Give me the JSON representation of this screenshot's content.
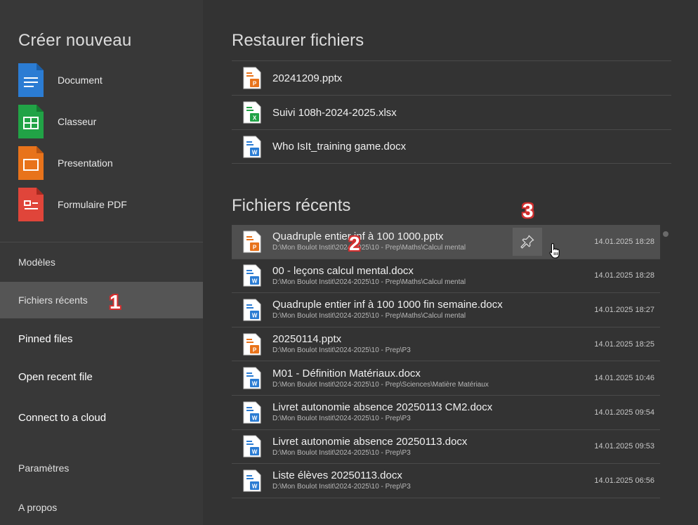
{
  "sidebar": {
    "create_title": "Créer nouveau",
    "create_items": [
      {
        "label": "Document",
        "icon": "word-doc-icon",
        "color": "#2b7cd3"
      },
      {
        "label": "Classeur",
        "icon": "spreadsheet-icon",
        "color": "#21a346"
      },
      {
        "label": "Presentation",
        "icon": "presentation-icon",
        "color": "#e8731b"
      },
      {
        "label": "Formulaire PDF",
        "icon": "pdf-form-icon",
        "color": "#e0453a"
      }
    ],
    "nav": {
      "models": "Modèles",
      "recent": "Fichiers récents",
      "pinned": "Pinned files",
      "open_recent": "Open recent file",
      "cloud": "Connect to a cloud",
      "settings": "Paramètres",
      "about": "A propos"
    }
  },
  "annotations": {
    "one": "1",
    "two": "2",
    "three": "3"
  },
  "main": {
    "restore_title": "Restaurer fichiers",
    "restore_files": [
      {
        "name": "20241209.pptx",
        "type": "pptx"
      },
      {
        "name": "Suivi 108h-2024-2025.xlsx",
        "type": "xlsx"
      },
      {
        "name": "Who IsIt_training game.docx",
        "type": "docx"
      }
    ],
    "recent_title": "Fichiers récents",
    "recent_files": [
      {
        "name": "Quadruple entier inf à 100 1000.pptx",
        "path": "D:\\Mon Boulot Instit\\2024-2025\\10 - Prep\\Maths\\Calcul mental",
        "date": "14.01.2025 18:28",
        "type": "pptx"
      },
      {
        "name": "00 - leçons calcul mental.docx",
        "path": "D:\\Mon Boulot Instit\\2024-2025\\10 - Prep\\Maths\\Calcul mental",
        "date": "14.01.2025 18:28",
        "type": "docx"
      },
      {
        "name": "Quadruple entier inf à 100 1000 fin semaine.docx",
        "path": "D:\\Mon Boulot Instit\\2024-2025\\10 - Prep\\Maths\\Calcul mental",
        "date": "14.01.2025 18:27",
        "type": "docx"
      },
      {
        "name": "20250114.pptx",
        "path": "D:\\Mon Boulot Instit\\2024-2025\\10 - Prep\\P3",
        "date": "14.01.2025 18:25",
        "type": "pptx"
      },
      {
        "name": "M01 - Définition Matériaux.docx",
        "path": "D:\\Mon Boulot Instit\\2024-2025\\10 - Prep\\Sciences\\Matière Matériaux",
        "date": "14.01.2025 10:46",
        "type": "docx"
      },
      {
        "name": "Livret autonomie absence 20250113 CM2.docx",
        "path": "D:\\Mon Boulot Instit\\2024-2025\\10 - Prep\\P3",
        "date": "14.01.2025 09:54",
        "type": "docx"
      },
      {
        "name": "Livret autonomie absence 20250113.docx",
        "path": "D:\\Mon Boulot Instit\\2024-2025\\10 - Prep\\P3",
        "date": "14.01.2025 09:53",
        "type": "docx"
      },
      {
        "name": "Liste élèves 20250113.docx",
        "path": "D:\\Mon Boulot Instit\\2024-2025\\10 - Prep\\P3",
        "date": "14.01.2025 06:56",
        "type": "docx"
      }
    ]
  },
  "colors": {
    "pptx": "#e8731b",
    "xlsx": "#21a346",
    "docx": "#2b7cd3"
  }
}
